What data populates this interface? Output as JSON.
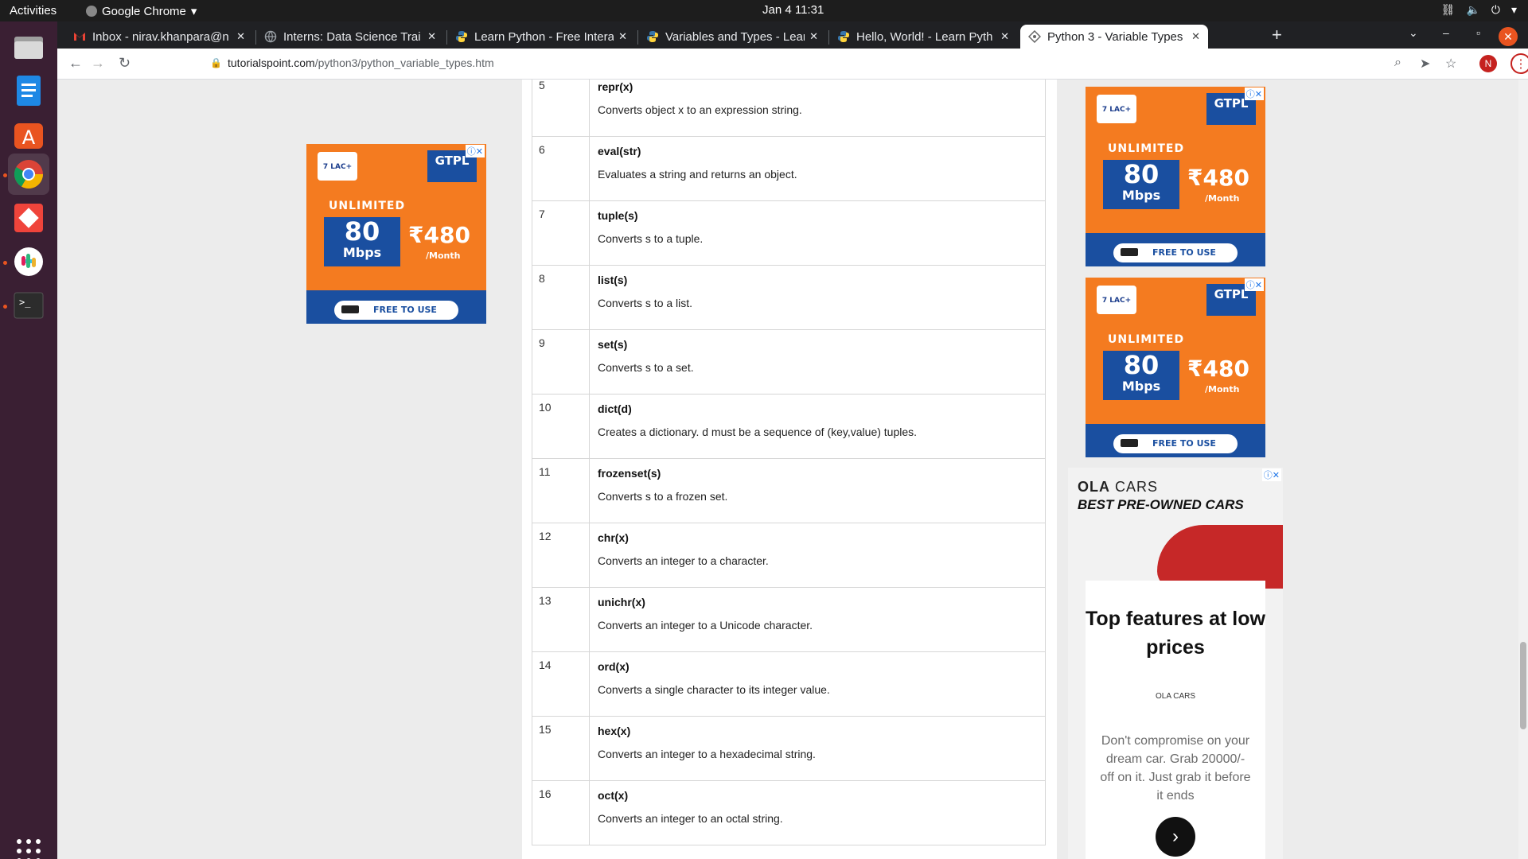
{
  "os": {
    "activities": "Activities",
    "app_name": "Google Chrome",
    "clock": "Jan 4  11:31"
  },
  "tabs": [
    {
      "title": "Inbox - nirav.khanpara@n",
      "icon": "gmail-icon"
    },
    {
      "title": "Interns: Data Science Trai",
      "icon": "globe-icon"
    },
    {
      "title": "Learn Python - Free Intera",
      "icon": "python-icon"
    },
    {
      "title": "Variables and Types - Lear",
      "icon": "python-icon"
    },
    {
      "title": "Hello, World! - Learn Pyth",
      "icon": "python-icon"
    },
    {
      "title": "Python 3 - Variable Types",
      "icon": "tutorialspoint-icon",
      "active": true
    }
  ],
  "address_bar": {
    "domain": "tutorialspoint.com",
    "path": "/python3/python_variable_types.htm"
  },
  "profile_initial": "N",
  "functions": [
    {
      "num": "5",
      "name": "repr(x)",
      "desc": "Converts object x to an expression string."
    },
    {
      "num": "6",
      "name": "eval(str)",
      "desc": "Evaluates a string and returns an object."
    },
    {
      "num": "7",
      "name": "tuple(s)",
      "desc": "Converts s to a tuple."
    },
    {
      "num": "8",
      "name": "list(s)",
      "desc": "Converts s to a list."
    },
    {
      "num": "9",
      "name": "set(s)",
      "desc": "Converts s to a set."
    },
    {
      "num": "10",
      "name": "dict(d)",
      "desc": "Creates a dictionary. d must be a sequence of (key,value) tuples."
    },
    {
      "num": "11",
      "name": "frozenset(s)",
      "desc": "Converts s to a frozen set."
    },
    {
      "num": "12",
      "name": "chr(x)",
      "desc": "Converts an integer to a character."
    },
    {
      "num": "13",
      "name": "unichr(x)",
      "desc": "Converts an integer to a Unicode character."
    },
    {
      "num": "14",
      "name": "ord(x)",
      "desc": "Converts a single character to its integer value."
    },
    {
      "num": "15",
      "name": "hex(x)",
      "desc": "Converts an integer to a hexadecimal string."
    },
    {
      "num": "16",
      "name": "oct(x)",
      "desc": "Converts an integer to an octal string."
    }
  ],
  "ad_gtpl": {
    "badge": "7 LAC+",
    "brand": "GTPL",
    "headline": "UNLIMITED",
    "speed": "80",
    "speed_unit": "Mbps",
    "price": "₹480",
    "per": "/Month",
    "cta": "FREE TO USE"
  },
  "ad_ola": {
    "brand_bold": "OLA",
    "brand_rest": " CARS",
    "tagline": "BEST PRE-OWNED CARS",
    "headline": "Top features at low prices",
    "logo": "OLA CARS",
    "body": "Don't compromise on your dream car. Grab 20000/- off on it. Just grab it before it ends"
  },
  "colors": {
    "ad_orange": "#f47b20",
    "ad_blue": "#1a4fa0",
    "dock": "#3a1f33",
    "accent": "#e95420"
  }
}
